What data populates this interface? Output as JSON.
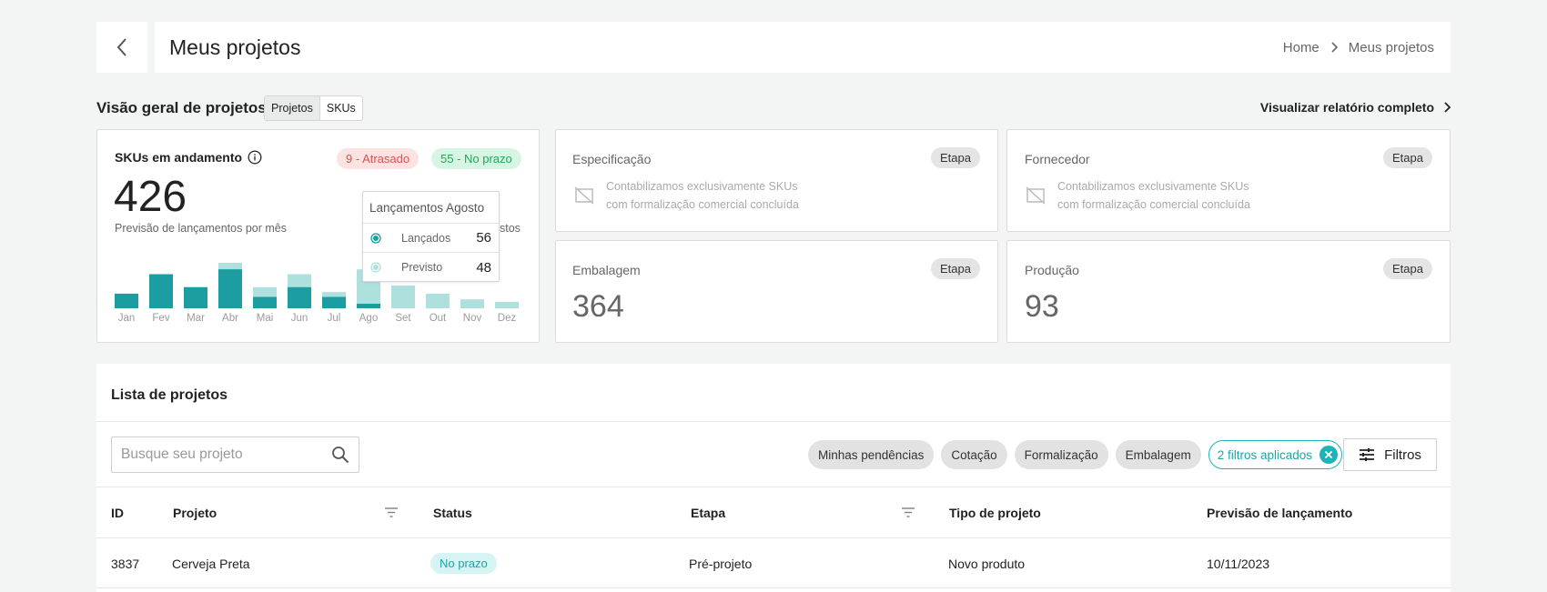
{
  "header": {
    "title": "Meus projetos",
    "breadcrumb": [
      "Home",
      "Meus projetos"
    ]
  },
  "overview": {
    "title": "Visão geral de projetos",
    "toggle": [
      "Projetos",
      "SKUs"
    ],
    "report_link": "Visualizar relatório completo"
  },
  "kpi": {
    "label": "SKUs em andamento",
    "late_badge": "9 - Atrasado",
    "ontime_badge": "55 - No prazo",
    "value": "426",
    "subtitle": "Previsão de lançamentos por mês",
    "subtitle_hidden_tail": "stos"
  },
  "chart_data": {
    "type": "bar",
    "categories": [
      "Jan",
      "Fev",
      "Mar",
      "Abr",
      "Mai",
      "Jun",
      "Jul",
      "Ago",
      "Set",
      "Out",
      "Nov",
      "Dez"
    ],
    "series": [
      {
        "name": "Lançados",
        "values": [
          18,
          42,
          26,
          48,
          14,
          26,
          14,
          56,
          0,
          0,
          0,
          0
        ]
      },
      {
        "name": "Previsto",
        "values": [
          18,
          42,
          26,
          56,
          26,
          42,
          20,
          48,
          28,
          18,
          11,
          8
        ]
      }
    ],
    "ylim": [
      0,
      56
    ],
    "colors": {
      "launched": "#1c9da1",
      "forecast": "#aee1de"
    }
  },
  "tooltip": {
    "title": "Lançamentos Agosto",
    "rows": [
      {
        "label": "Lançados",
        "value": "56"
      },
      {
        "label": "Previsto",
        "value": "48"
      }
    ]
  },
  "stages": {
    "badge": "Etapa",
    "note_line1": "Contabilizamos exclusivamente SKUs",
    "note_line2": "com formalização comercial concluída",
    "especificacao": {
      "title": "Especificação"
    },
    "fornecedor": {
      "title": "Fornecedor"
    },
    "embalagem": {
      "title": "Embalagem",
      "value": "364"
    },
    "producao": {
      "title": "Produção",
      "value": "93"
    }
  },
  "list": {
    "title": "Lista de projetos",
    "search_placeholder": "Busque seu projeto",
    "chips": [
      "Minhas pendências",
      "Cotação",
      "Formalização",
      "Embalagem"
    ],
    "active_filter": "2 filtros aplicados",
    "filter_button": "Filtros",
    "columns": [
      "ID",
      "Projeto",
      "Status",
      "Etapa",
      "Tipo de projeto",
      "Previsão de lançamento"
    ],
    "rows": [
      {
        "id": "3837",
        "project": "Cerveja Preta",
        "status": "No prazo",
        "stage": "Pré-projeto",
        "type": "Novo produto",
        "date": "10/11/2023"
      }
    ]
  }
}
